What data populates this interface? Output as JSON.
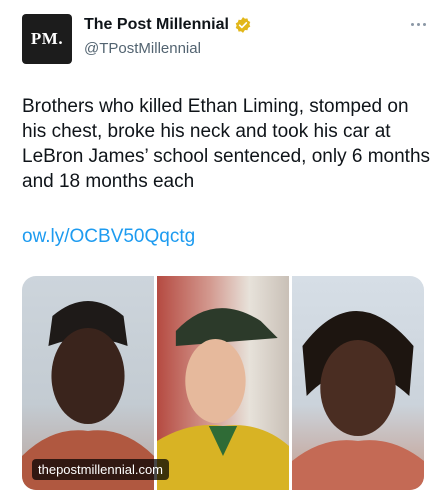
{
  "account": {
    "avatar_text": "PM.",
    "display_name": "The Post Millennial",
    "handle": "@TPostMillennial",
    "verified_badge_color": "#e2b719"
  },
  "tweet": {
    "text": "Brothers who killed Ethan Liming, stomped on his chest, broke his neck and took his car at LeBron James’ school sentenced, only 6 months and 18 months each",
    "link": "ow.ly/OCBV50Qqctg"
  },
  "media": {
    "source_label": "thepostmillennial.com",
    "photos": [
      {
        "description_icon": "mugshot-photo"
      },
      {
        "description_icon": "portrait-photo"
      },
      {
        "description_icon": "mugshot-photo"
      }
    ]
  },
  "colors": {
    "link": "#1d9bf0",
    "text": "#0f1419",
    "muted": "#536471"
  }
}
